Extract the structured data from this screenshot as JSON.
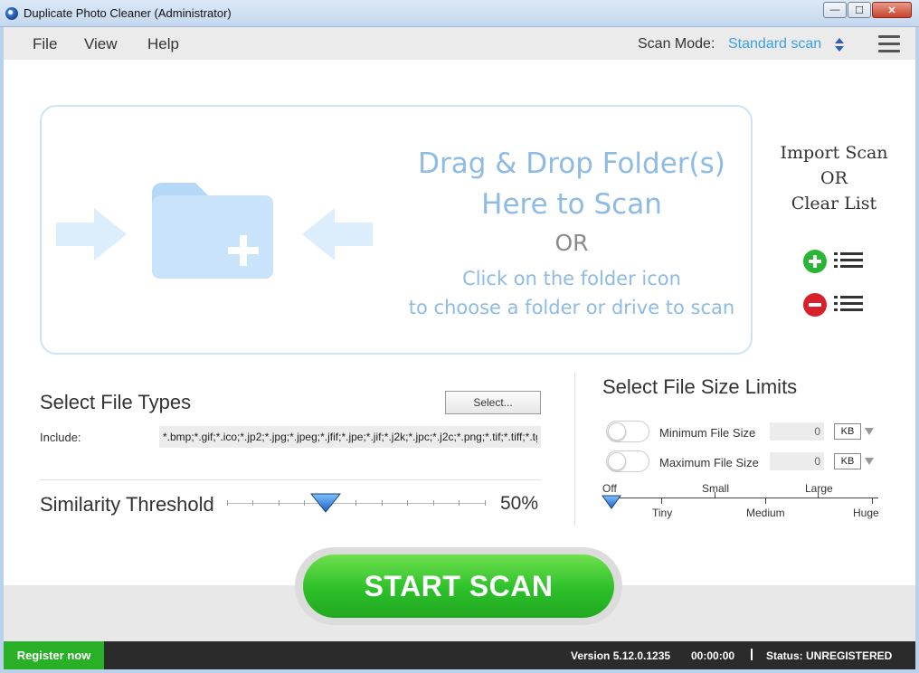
{
  "window": {
    "title": "Duplicate Photo Cleaner (Administrator)",
    "controls": {
      "minimize": "—",
      "maximize": "☐",
      "close": "✕"
    }
  },
  "menu": {
    "items": [
      "File",
      "View",
      "Help"
    ],
    "scan_mode_label": "Scan Mode:",
    "scan_mode_value": "Standard scan"
  },
  "dropzone": {
    "line1": "Drag & Drop Folder(s)",
    "line2": "Here to Scan",
    "line3": "OR",
    "line4": "Click on the folder icon",
    "line5": "to choose a folder or drive to scan"
  },
  "import_panel": {
    "line1": "Import Scan",
    "line2": "OR",
    "line3": "Clear List"
  },
  "file_types": {
    "title": "Select File Types",
    "select_button": "Select...",
    "include_label": "Include:",
    "include_value": "*.bmp;*.gif;*.ico;*.jp2;*.jpg;*.jpeg;*.jfif;*.jpe;*.jif;*.j2k;*.jpc;*.j2c;*.png;*.tif;*.tiff;*.tg"
  },
  "similarity": {
    "title": "Similarity Threshold",
    "value_label": "50%",
    "value": 50
  },
  "size_limits": {
    "title": "Select File Size Limits",
    "min_label": "Minimum File Size",
    "min_value": "0",
    "min_unit": "KB",
    "max_label": "Maximum File Size",
    "max_value": "0",
    "max_unit": "KB",
    "scale_top": [
      "Off",
      "Small",
      "Large"
    ],
    "scale_bottom": [
      "Tiny",
      "Medium",
      "Huge"
    ]
  },
  "actions": {
    "start_scan": "START SCAN"
  },
  "status": {
    "register": "Register now",
    "version": "Version 5.12.0.1235",
    "timer": "00:00:00",
    "status": "Status: UNREGISTERED"
  },
  "colors": {
    "accent_blue": "#3aa0e8",
    "drop_text": "#8dbbe6",
    "scan_green": "#2cc02a",
    "status_bar": "#2b2b2b"
  }
}
